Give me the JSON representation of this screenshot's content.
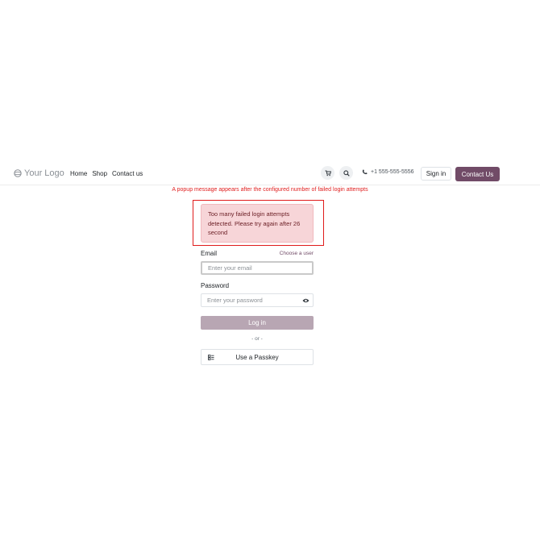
{
  "header": {
    "logo_text": "Your Logo",
    "nav": [
      "Home",
      "Shop",
      "Contact us"
    ],
    "phone": "+1 555-555-5556",
    "sign_in": "Sign in",
    "contact_us": "Contact Us",
    "icons": [
      "cart-icon",
      "search-icon",
      "phone-icon"
    ]
  },
  "annotation": "A popup message appears after the configured number of failed login attempts",
  "alert": {
    "message": "Too many failed login attempts detected. Please try again after 26 second"
  },
  "form": {
    "email_label": "Email",
    "choose_user": "Choose a user",
    "email_placeholder": "Enter your email",
    "password_label": "Password",
    "password_placeholder": "Enter your password",
    "login_button": "Log in",
    "or_text": "- or -",
    "passkey_button": "Use a Passkey"
  },
  "colors": {
    "brand": "#714b67",
    "alert_bg": "#f7d5d8",
    "annotation": "#e02020"
  }
}
